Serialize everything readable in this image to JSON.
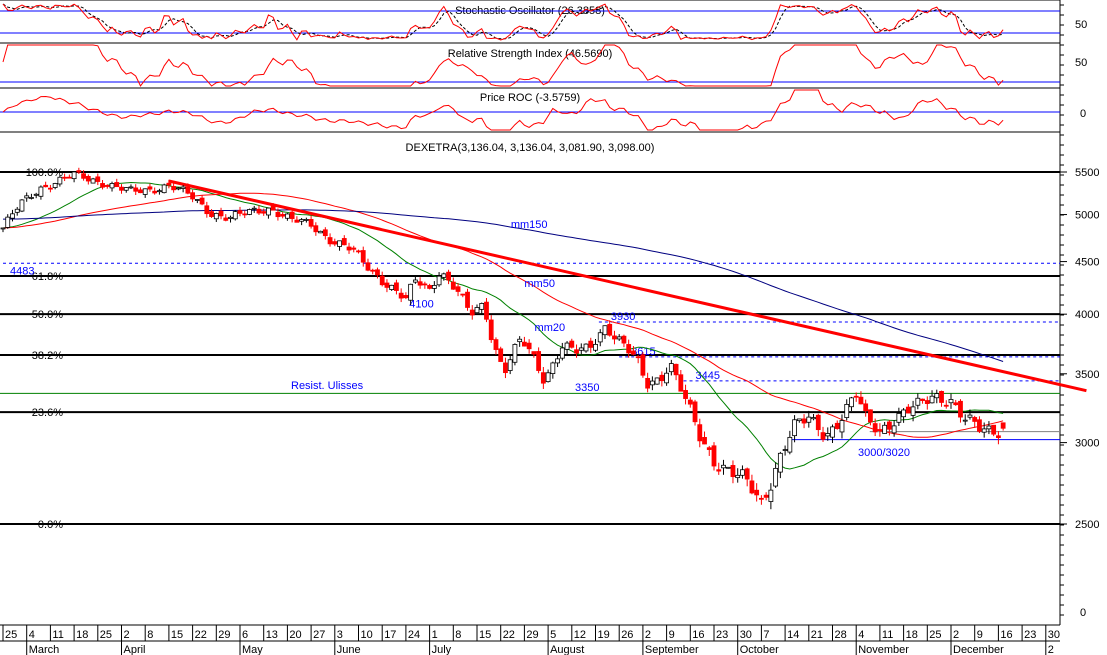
{
  "colors": {
    "up_fill": "#ffffff",
    "down_fill": "#ff0000",
    "candle_outline": "#000000",
    "blue": "#0000ff",
    "red": "#ff0000",
    "green": "#008000",
    "navy": "#000080",
    "trend": "#ff0000"
  },
  "panels": {
    "stochastic": {
      "title": "Stochastic Oscillator (26.3858)",
      "axis_label": "50",
      "levels": [
        20,
        80
      ]
    },
    "rsi": {
      "title": "Relative Strength Index (46.5690)",
      "axis_label": "50",
      "levels": [
        30
      ]
    },
    "roc": {
      "title": "Price ROC (-3.5759)",
      "axis_label": "0",
      "levels": [
        0
      ]
    },
    "price_title": "DEXETRA(3,136.04, 3,136.04, 3,081.90, 3,098.00)"
  },
  "chart_data": {
    "type": "candlestick",
    "title": "DEXETRA(3,136.04, 3,136.04, 3,081.90, 3,098.00)",
    "scale": "log",
    "ylim": [
      2500,
      5500
    ],
    "y_ticks": [
      "5500",
      "5000",
      "4500",
      "4000",
      "3500",
      "3000",
      "2500"
    ],
    "y_tick_values": [
      5500,
      5000,
      4500,
      4000,
      3500,
      3000,
      2500
    ],
    "volume_axis_label": "0",
    "last_candle": {
      "open": 3136.04,
      "high": 3136.04,
      "low": 3081.9,
      "close": 3098.0
    },
    "close_path_days": [
      0,
      5,
      11,
      17,
      21,
      29,
      38,
      43,
      49,
      55,
      61,
      67,
      73,
      79,
      85,
      91,
      97,
      103,
      108,
      114,
      119,
      122,
      126,
      129,
      134,
      138,
      142,
      145,
      148,
      153,
      157,
      160,
      165,
      169,
      173,
      178,
      182,
      187,
      190,
      194,
      197,
      201,
      206,
      210,
      215,
      219,
      224,
      227,
      230,
      234,
      238,
      243,
      247,
      252,
      255,
      259,
      265,
      271,
      275,
      280,
      284,
      289,
      293,
      296
    ],
    "close_path_values": [
      4852,
      5108,
      5307,
      5402,
      5463,
      5378,
      5259,
      5283,
      5342,
      5224,
      5028,
      4962,
      5028,
      5074,
      4940,
      4886,
      4725,
      4618,
      4436,
      4270,
      4129,
      4318,
      4223,
      4415,
      4223,
      3993,
      4083,
      3734,
      3530,
      3776,
      3609,
      3452,
      3734,
      3675,
      3692,
      3904,
      3776,
      3609,
      3413,
      3468,
      3594,
      3338,
      3019,
      2885,
      2821,
      2759,
      2609,
      2759,
      2951,
      3121,
      3156,
      3052,
      3156,
      3338,
      3156,
      3086,
      3192,
      3264,
      3338,
      3300,
      3156,
      3086,
      3086,
      3098
    ],
    "moving_averages": [
      {
        "name": "mm20",
        "period": 20,
        "color": "#008000"
      },
      {
        "name": "mm50",
        "period": 50,
        "color": "#ff0000"
      },
      {
        "name": "mm150",
        "period": 150,
        "color": "#000080"
      }
    ],
    "fib_levels": [
      {
        "label": "100.0%",
        "value": 5500
      },
      {
        "label": "61.8%",
        "value": 4357
      },
      {
        "label": "50.0%",
        "value": 4000
      },
      {
        "label": "38.2%",
        "value": 3650
      },
      {
        "label": "23.6%",
        "value": 3212
      },
      {
        "label": "0.0%",
        "value": 2500
      }
    ],
    "dashed_levels": [
      {
        "label": "4483",
        "value": 4483,
        "from_day": 0
      },
      {
        "label": "3930",
        "value": 3930,
        "from_day": 176
      },
      {
        "label": "3615",
        "value": 3635,
        "from_day": 182
      },
      {
        "label": "3445",
        "value": 3445,
        "from_day": 201
      }
    ],
    "resistance": {
      "label": "Resist. Ulisses",
      "value": 3350,
      "label2": "3350"
    },
    "support": {
      "label": "3000/3020",
      "value": 3020,
      "from_day": 232
    },
    "support2": {
      "value": 3075,
      "from_day": 256
    },
    "trendline": {
      "from_day": 49,
      "from_value": 5390,
      "to_day": 320,
      "to_value": 3370
    },
    "annotations": [
      {
        "text": "mm150",
        "day": 150,
        "value": 4850
      },
      {
        "text": "mm50",
        "day": 154,
        "value": 4250
      },
      {
        "text": "mm20",
        "day": 157,
        "value": 3850
      },
      {
        "text": "4100",
        "day": 120,
        "value": 4060
      }
    ],
    "x_ticks": [
      "25",
      "4",
      "11",
      "18",
      "25",
      "2",
      "8",
      "15",
      "22",
      "29",
      "6",
      "13",
      "20",
      "27",
      "3",
      "10",
      "17",
      "24",
      "1",
      "8",
      "15",
      "22",
      "29",
      "5",
      "12",
      "19",
      "26",
      "2",
      "9",
      "16",
      "23",
      "30",
      "7",
      "14",
      "21",
      "28",
      "4",
      "11",
      "18",
      "25",
      "2",
      "9",
      "16",
      "23",
      "30"
    ],
    "months": [
      {
        "label": "March",
        "tick": 1
      },
      {
        "label": "April",
        "tick": 5
      },
      {
        "label": "May",
        "tick": 10
      },
      {
        "label": "June",
        "tick": 14
      },
      {
        "label": "July",
        "tick": 18
      },
      {
        "label": "August",
        "tick": 23
      },
      {
        "label": "September",
        "tick": 27
      },
      {
        "label": "October",
        "tick": 31
      },
      {
        "label": "November",
        "tick": 36
      },
      {
        "label": "December",
        "tick": 40
      },
      {
        "label": "2",
        "tick": 44
      }
    ]
  }
}
